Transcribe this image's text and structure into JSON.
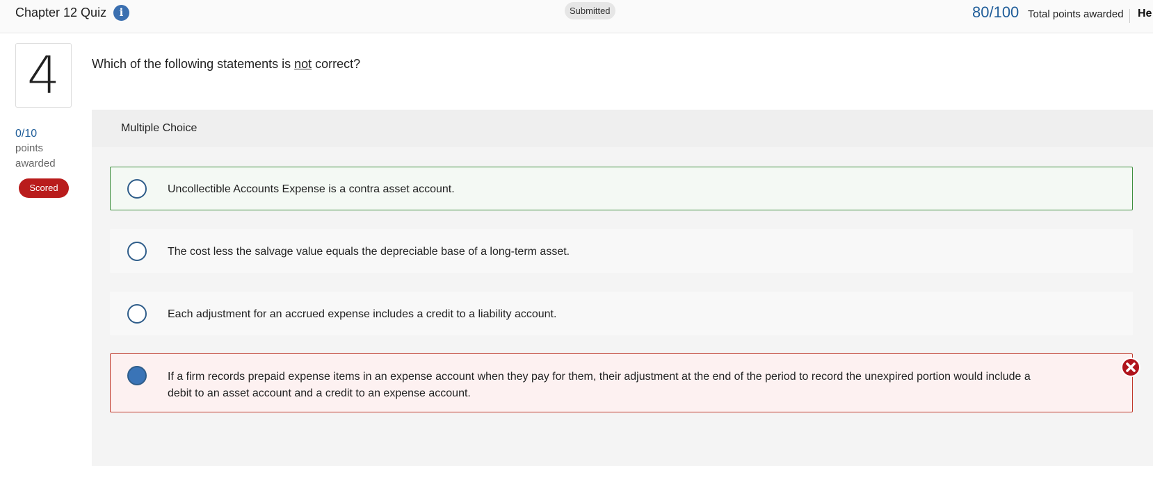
{
  "header": {
    "quiz_title": "Chapter 12 Quiz",
    "info_icon": "info-icon",
    "status": "Submitted",
    "score": "80/100",
    "score_label": "Total points awarded",
    "help": "He"
  },
  "question": {
    "number": "4",
    "text_before": "Which of the following statements is ",
    "text_emph": "not",
    "text_after": " correct?",
    "points": "0/10",
    "points_label_line1": "points",
    "points_label_line2": "awarded",
    "scored_badge": "Scored"
  },
  "choices": {
    "type_label": "Multiple Choice",
    "options": [
      {
        "text": "Uncollectible Accounts Expense is a contra asset account.",
        "state": "correct-answer",
        "selected": false
      },
      {
        "text": "The cost less the salvage value equals the depreciable base of a long-term asset.",
        "state": "neutral",
        "selected": false
      },
      {
        "text": "Each adjustment for an accrued expense includes a credit to a liability account.",
        "state": "neutral",
        "selected": false
      },
      {
        "text": "If a firm records prepaid expense items in an expense account when they pay for them, their adjustment at the end of the period to record the unexpired portion would include a",
        "text_line2": "debit to an asset account and a credit to an expense account.",
        "state": "incorrect-selected",
        "selected": true
      }
    ]
  },
  "colors": {
    "accent": "#1f5d99",
    "correct_border": "#3e8e3e",
    "wrong_border": "#c0392b",
    "badge_red": "#b91c1c"
  }
}
